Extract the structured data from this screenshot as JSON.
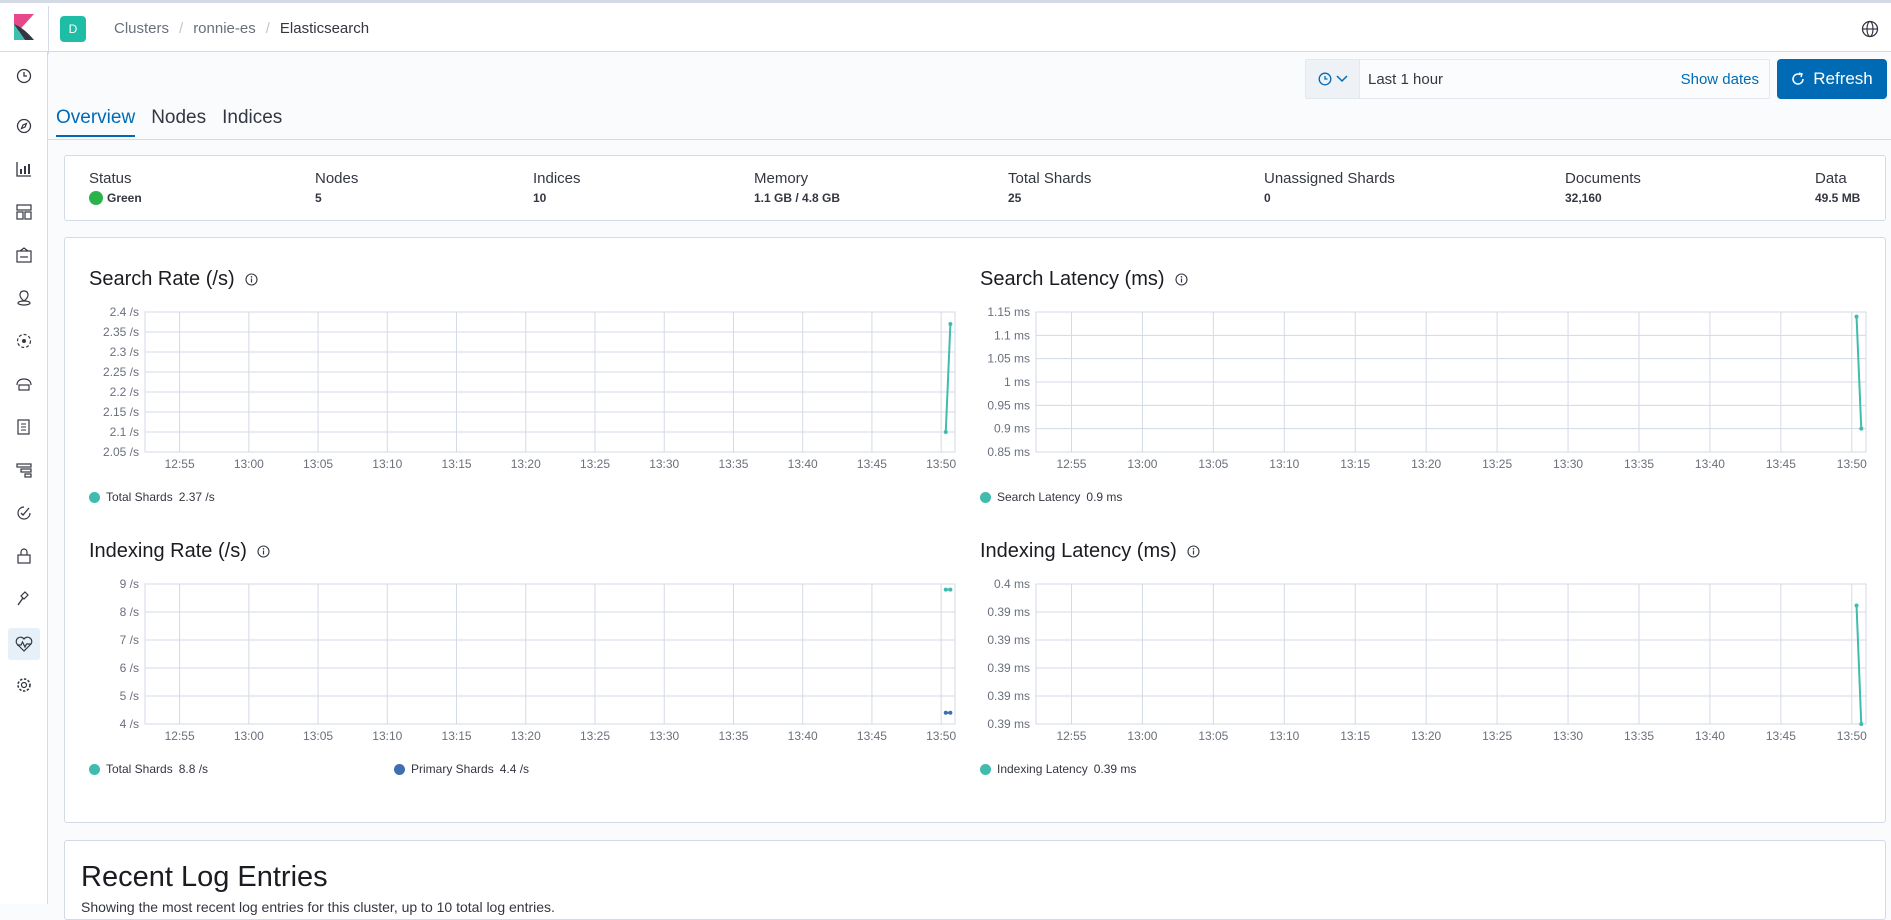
{
  "header": {
    "space_initial": "D",
    "breadcrumbs": [
      "Clusters",
      "ronnie-es",
      "Elasticsearch"
    ],
    "separator": "/"
  },
  "sidebar": {
    "icons": [
      "recent-icon",
      "discover-icon",
      "visualize-icon",
      "dashboard-icon",
      "canvas-icon",
      "maps-icon",
      "ml-icon",
      "infrastructure-icon",
      "logs-icon",
      "apm-icon",
      "uptime-icon",
      "siem-icon",
      "dev-tools-icon",
      "monitoring-icon",
      "management-icon"
    ],
    "active": "monitoring-icon"
  },
  "timepicker": {
    "label": "Last 1 hour",
    "show_dates": "Show dates",
    "refresh": "Refresh"
  },
  "tabs": [
    "Overview",
    "Nodes",
    "Indices"
  ],
  "summary": {
    "status": {
      "label": "Status",
      "value": "Green"
    },
    "nodes": {
      "label": "Nodes",
      "value": "5"
    },
    "indices": {
      "label": "Indices",
      "value": "10"
    },
    "memory": {
      "label": "Memory",
      "value": "1.1 GB / 4.8 GB"
    },
    "total_shards": {
      "label": "Total Shards",
      "value": "25"
    },
    "unassigned": {
      "label": "Unassigned Shards",
      "value": "0"
    },
    "documents": {
      "label": "Documents",
      "value": "32,160"
    },
    "data": {
      "label": "Data",
      "value": "49.5 MB"
    }
  },
  "colors": {
    "teal": "#3fbcad",
    "blue": "#3f6faf",
    "accent": "#006bb4"
  },
  "chart_data": [
    {
      "type": "line",
      "title": "Search Rate (/s)",
      "x_ticks": [
        "12:55",
        "13:00",
        "13:05",
        "13:10",
        "13:15",
        "13:20",
        "13:25",
        "13:30",
        "13:35",
        "13:40",
        "13:45",
        "13:50"
      ],
      "y_ticks": [
        "2.4 /s",
        "2.35 /s",
        "2.3 /s",
        "2.25 /s",
        "2.2 /s",
        "2.15 /s",
        "2.1 /s",
        "2.05 /s"
      ],
      "ylim": [
        2.05,
        2.4
      ],
      "series": [
        {
          "name": "Total Shards",
          "legend_value": "2.37 /s",
          "color": "#3fbcad",
          "x": [
            "13:50:20",
            "13:50:40"
          ],
          "values": [
            2.1,
            2.37
          ]
        }
      ]
    },
    {
      "type": "line",
      "title": "Search Latency (ms)",
      "x_ticks": [
        "12:55",
        "13:00",
        "13:05",
        "13:10",
        "13:15",
        "13:20",
        "13:25",
        "13:30",
        "13:35",
        "13:40",
        "13:45",
        "13:50"
      ],
      "y_ticks": [
        "1.15 ms",
        "1.1 ms",
        "1.05 ms",
        "1 ms",
        "0.95 ms",
        "0.9 ms",
        "0.85 ms"
      ],
      "ylim": [
        0.85,
        1.15
      ],
      "series": [
        {
          "name": "Search Latency",
          "legend_value": "0.9 ms",
          "color": "#3fbcad",
          "x": [
            "13:50:20",
            "13:50:40"
          ],
          "values": [
            1.14,
            0.9
          ]
        }
      ]
    },
    {
      "type": "line",
      "title": "Indexing Rate (/s)",
      "x_ticks": [
        "12:55",
        "13:00",
        "13:05",
        "13:10",
        "13:15",
        "13:20",
        "13:25",
        "13:30",
        "13:35",
        "13:40",
        "13:45",
        "13:50"
      ],
      "y_ticks": [
        "9 /s",
        "8 /s",
        "7 /s",
        "6 /s",
        "5 /s",
        "4 /s"
      ],
      "ylim": [
        4,
        9
      ],
      "series": [
        {
          "name": "Total Shards",
          "legend_value": "8.8 /s",
          "color": "#3fbcad",
          "x": [
            "13:50:20",
            "13:50:40"
          ],
          "values": [
            8.8,
            8.8
          ]
        },
        {
          "name": "Primary Shards",
          "legend_value": "4.4 /s",
          "color": "#3f6faf",
          "x": [
            "13:50:20",
            "13:50:40"
          ],
          "values": [
            4.4,
            4.4
          ]
        }
      ]
    },
    {
      "type": "line",
      "title": "Indexing Latency (ms)",
      "x_ticks": [
        "12:55",
        "13:00",
        "13:05",
        "13:10",
        "13:15",
        "13:20",
        "13:25",
        "13:30",
        "13:35",
        "13:40",
        "13:45",
        "13:50"
      ],
      "y_ticks": [
        "0.4 ms",
        "0.39 ms",
        "0.39 ms",
        "0.39 ms",
        "0.39 ms",
        "0.39 ms"
      ],
      "ylim": [
        0.387,
        0.4
      ],
      "series": [
        {
          "name": "Indexing Latency",
          "legend_value": "0.39 ms",
          "color": "#3fbcad",
          "x": [
            "13:50:20",
            "13:50:40"
          ],
          "values": [
            0.398,
            0.387
          ]
        }
      ]
    }
  ],
  "log": {
    "title": "Recent Log Entries",
    "subtitle": "Showing the most recent log entries for this cluster, up to 10 total log entries."
  }
}
